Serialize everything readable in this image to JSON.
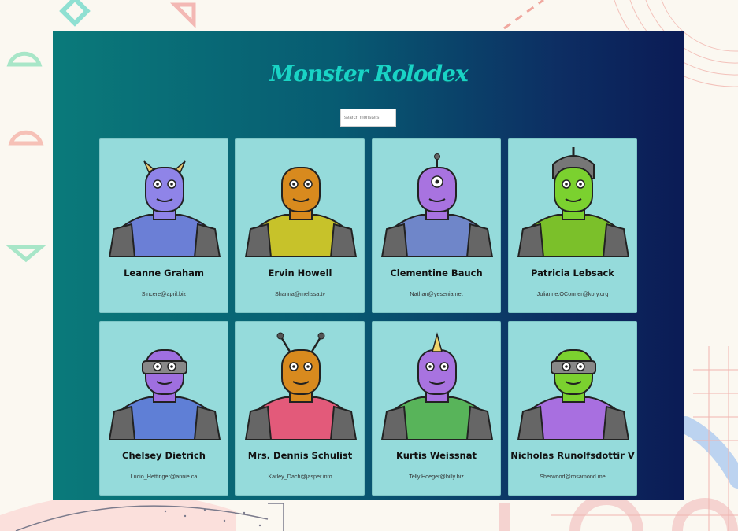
{
  "app": {
    "title": "Monster Rolodex",
    "search": {
      "placeholder": "search monsters"
    }
  },
  "monsters": [
    {
      "name": "Leanne Graham",
      "email": "Sincere@april.biz",
      "icon": "purple-horned-monster",
      "skin": "#8f84e8",
      "body": "#6b7fd6"
    },
    {
      "name": "Ervin Howell",
      "email": "Shanna@melissa.tv",
      "icon": "orange-grinning-monster",
      "skin": "#d88a1e",
      "body": "#c7c22a"
    },
    {
      "name": "Clementine Bauch",
      "email": "Nathan@yesenia.net",
      "icon": "purple-cyclops-monster",
      "skin": "#a873e0",
      "body": "#6f86c9"
    },
    {
      "name": "Patricia Lebsack",
      "email": "Julianne.OConner@kory.org",
      "icon": "green-helmet-monster",
      "skin": "#7bd12f",
      "body": "#7bc02a"
    },
    {
      "name": "Chelsey Dietrich",
      "email": "Lucio_Hettinger@annie.ca",
      "icon": "purple-visor-monster",
      "skin": "#9f6fe0",
      "body": "#5f7fd6"
    },
    {
      "name": "Mrs. Dennis Schulist",
      "email": "Karley_Dach@jasper.info",
      "icon": "orange-antenna-monster",
      "skin": "#d88a1e",
      "body": "#e35a7a"
    },
    {
      "name": "Kurtis Weissnat",
      "email": "Telly.Hoeger@billy.biz",
      "icon": "purple-unicorn-monster",
      "skin": "#a873e0",
      "body": "#58b45a"
    },
    {
      "name": "Nicholas Runolfsdottir V",
      "email": "Sherwood@rosamond.me",
      "icon": "green-visor-monster",
      "skin": "#7bd12f",
      "body": "#a86fe0"
    }
  ]
}
